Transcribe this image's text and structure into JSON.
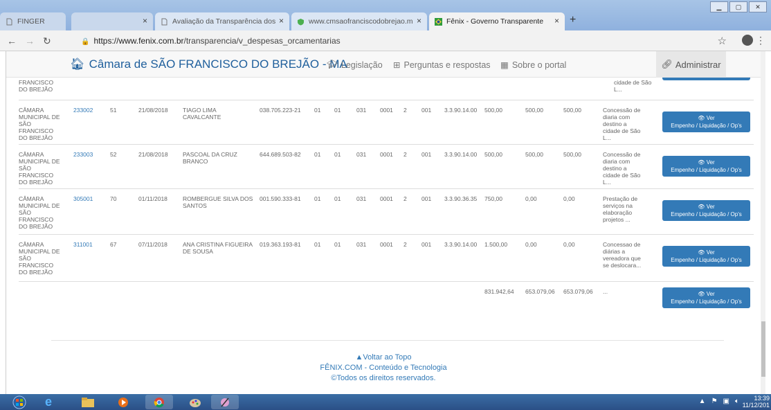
{
  "browser": {
    "tabs": [
      {
        "title": "FINGER",
        "active": false
      },
      {
        "title": "",
        "active": false
      },
      {
        "title": "Avaliação da Transparência dos",
        "active": false
      },
      {
        "title": "www.cmsaofranciscodobrejao.m",
        "active": false
      },
      {
        "title": "Fênix - Governo Transparente",
        "active": true
      }
    ],
    "url_host": "https://www.fenix.com.br",
    "url_path": "/transparencia/v_despesas_orcamentarias"
  },
  "navbar": {
    "brand": "Câmara de SÃO FRANCISCO DO BREJÃO - MA",
    "links": [
      "Legislação",
      "Perguntas e respostas",
      "Sobre o portal"
    ],
    "admin": "Administrar"
  },
  "table": {
    "partial_top": {
      "orgao": "FRANCISCO\nDO BREJÃO",
      "historico": "cidade de São\nL..."
    },
    "rows": [
      {
        "orgao": "CÂMARA\nMUNICIPAL DE\nSÃO\nFRANCISCO\nDO BREJÃO",
        "empenho": "233002",
        "num": "51",
        "data": "21/08/2018",
        "credor": "TIAGO LIMA\nCAVALCANTE",
        "cpf": "038.705.223-21",
        "c1": "01",
        "c2": "01",
        "c3": "031",
        "c4": "0001",
        "c5": "2",
        "c6": "001",
        "natureza": "3.3.90.14.00",
        "empenhado": "500,00",
        "liquidado": "500,00",
        "pago": "500,00",
        "historico": "Concessão de\ndiaria com\ndestino a\ncidade de São\nL..."
      },
      {
        "orgao": "CÂMARA\nMUNICIPAL DE\nSÃO\nFRANCISCO\nDO BREJÃO",
        "empenho": "233003",
        "num": "52",
        "data": "21/08/2018",
        "credor": "PASCOAL DA CRUZ\nBRANCO",
        "cpf": "644.689.503-82",
        "c1": "01",
        "c2": "01",
        "c3": "031",
        "c4": "0001",
        "c5": "2",
        "c6": "001",
        "natureza": "3.3.90.14.00",
        "empenhado": "500,00",
        "liquidado": "500,00",
        "pago": "500,00",
        "historico": "Concessão de\ndiaria com\ndestino a\ncidade de São\nL..."
      },
      {
        "orgao": "CÂMARA\nMUNICIPAL DE\nSÃO\nFRANCISCO\nDO BREJÃO",
        "empenho": "305001",
        "num": "70",
        "data": "01/11/2018",
        "credor": "ROMBERGUE SILVA DOS\nSANTOS",
        "cpf": "001.590.333-81",
        "c1": "01",
        "c2": "01",
        "c3": "031",
        "c4": "0001",
        "c5": "2",
        "c6": "001",
        "natureza": "3.3.90.36.35",
        "empenhado": "750,00",
        "liquidado": "0,00",
        "pago": "0,00",
        "historico": "Prestação de\nserviços na\nelaboração\nprojetos ..."
      },
      {
        "orgao": "CÂMARA\nMUNICIPAL DE\nSÃO\nFRANCISCO\nDO BREJÃO",
        "empenho": "311001",
        "num": "67",
        "data": "07/11/2018",
        "credor": "ANA CRISTINA FIGUEIRA\nDE SOUSA",
        "cpf": "019.363.193-81",
        "c1": "01",
        "c2": "01",
        "c3": "031",
        "c4": "0001",
        "c5": "2",
        "c6": "001",
        "natureza": "3.3.90.14.00",
        "empenhado": "1.500,00",
        "liquidado": "0,00",
        "pago": "0,00",
        "historico": "Concessao de\ndiárias a\nvereadora que\nse deslocara..."
      }
    ],
    "totals": {
      "empenhado": "831.942,64",
      "liquidado": "653.079,06",
      "pago": "653.079,06",
      "historico": "..."
    },
    "ver_label": "Ver",
    "ver_sub": "Empenho / Liquidação / Op's"
  },
  "footer": {
    "top": "Voltar ao Topo",
    "company": "FÊNIX.COM - Conteúdo e Tecnologia",
    "rights": "©Todos os direitos reservados."
  },
  "taskbar": {
    "time": "13:39",
    "date": "11/12/201"
  },
  "colors": {
    "brand": "#1f5f9c",
    "link": "#337ab7",
    "button": "#337ab7"
  }
}
